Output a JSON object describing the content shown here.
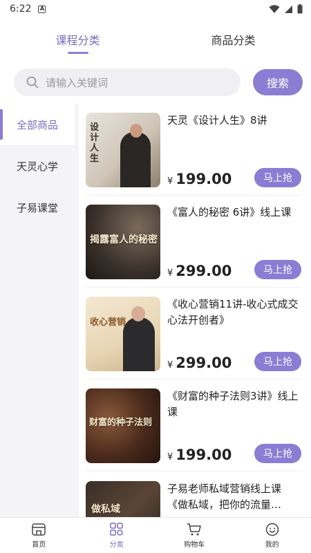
{
  "status": {
    "time": "6:22",
    "sim_letter": "A"
  },
  "tabs": [
    {
      "label": "课程分类",
      "active": true
    },
    {
      "label": "商品分类",
      "active": false
    }
  ],
  "search": {
    "placeholder": "请输入关键词",
    "button": "搜索"
  },
  "sidebar": {
    "items": [
      {
        "label": "全部商品",
        "active": true
      },
      {
        "label": "天灵心学",
        "active": false
      },
      {
        "label": "子易课堂",
        "active": false
      }
    ]
  },
  "products": [
    {
      "title": "天灵《设计人生》8讲",
      "currency": "¥",
      "price": "199.00",
      "button": "马上抢",
      "thumb_text": "设计人生"
    },
    {
      "title": "《富人的秘密 6讲》线上课",
      "currency": "¥",
      "price": "299.00",
      "button": "马上抢",
      "thumb_text": "揭露富人的秘密"
    },
    {
      "title": "《收心营销11讲-收心式成交心法开创者》",
      "currency": "¥",
      "price": "299.00",
      "button": "马上抢",
      "thumb_text": "收心营销"
    },
    {
      "title": "《财富的种子法则3讲》线上课",
      "currency": "¥",
      "price": "199.00",
      "button": "马上抢",
      "thumb_text": "财富的种子法则"
    },
    {
      "title": "子易老师私域营销线上课《做私域，把你的流量…",
      "currency": "",
      "price": "",
      "button": "",
      "thumb_text": "做私域"
    }
  ],
  "bottom_nav": [
    {
      "label": "首页",
      "icon": "home-icon",
      "active": false
    },
    {
      "label": "分类",
      "icon": "category-icon",
      "active": true
    },
    {
      "label": "购物车",
      "icon": "cart-icon",
      "active": false
    },
    {
      "label": "我的",
      "icon": "profile-icon",
      "active": false
    }
  ],
  "colors": {
    "accent": "#8b7dd3",
    "accent_text": "#7b6cc0"
  }
}
